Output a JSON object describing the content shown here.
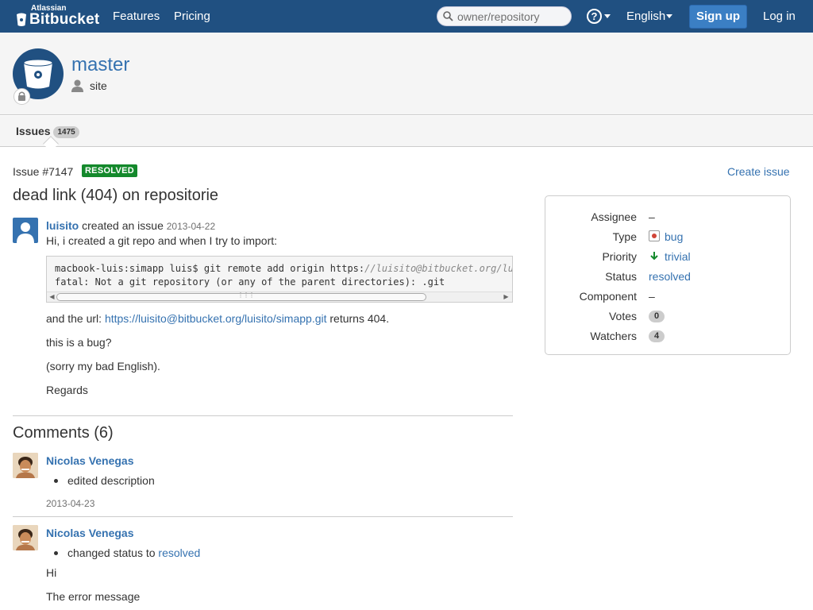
{
  "nav": {
    "brand_small": "Atlassian",
    "brand_main": "Bitbucket",
    "features": "Features",
    "pricing": "Pricing",
    "search_placeholder": "owner/repository",
    "help_glyph": "?",
    "language": "English",
    "signup": "Sign up",
    "login": "Log in"
  },
  "repo": {
    "name": "master",
    "owner": "site"
  },
  "tabs": {
    "issues_label": "Issues",
    "issues_count": "1475"
  },
  "issue": {
    "id": "Issue #7147",
    "status_badge": "RESOLVED",
    "create_link": "Create issue",
    "title": "dead link (404) on repositorie",
    "author": "luisito",
    "action": "created an issue",
    "date": "2013-04-22",
    "intro": "Hi, i created a git repo and when I try to import:",
    "code_line1_prefix": "macbook-luis:simapp luis$ git remote add origin https:",
    "code_line1_comment": "//luisito@bitbucket.org/luisito/simapp.git",
    "code_line2": "fatal: Not a git repository (or any of the parent directories): .git",
    "url_prefix": "and the url: ",
    "url": "https://luisito@bitbucket.org/luisito/simapp.git",
    "url_suffix": " returns 404.",
    "line_bug": "this is a bug?",
    "line_sorry": "(sorry my bad English).",
    "line_regards": "Regards"
  },
  "comments": {
    "heading": "Comments (6)",
    "items": [
      {
        "author": "Nicolas Venegas",
        "bullet": "edited description",
        "date": "2013-04-23"
      },
      {
        "author": "Nicolas Venegas",
        "bullet_prefix": "changed status to ",
        "bullet_link": "resolved",
        "body_line1": "Hi",
        "body_line2": "The error message"
      }
    ]
  },
  "sidebar": {
    "assignee_label": "Assignee",
    "assignee_value": "–",
    "type_label": "Type",
    "type_value": "bug",
    "priority_label": "Priority",
    "priority_value": "trivial",
    "status_label": "Status",
    "status_value": "resolved",
    "component_label": "Component",
    "component_value": "–",
    "votes_label": "Votes",
    "votes_value": "0",
    "watchers_label": "Watchers",
    "watchers_value": "4"
  },
  "colors": {
    "nav_bg": "#205081",
    "link": "#3572b0",
    "resolved_badge": "#14892c",
    "signup_button": "#3b7fc4"
  }
}
